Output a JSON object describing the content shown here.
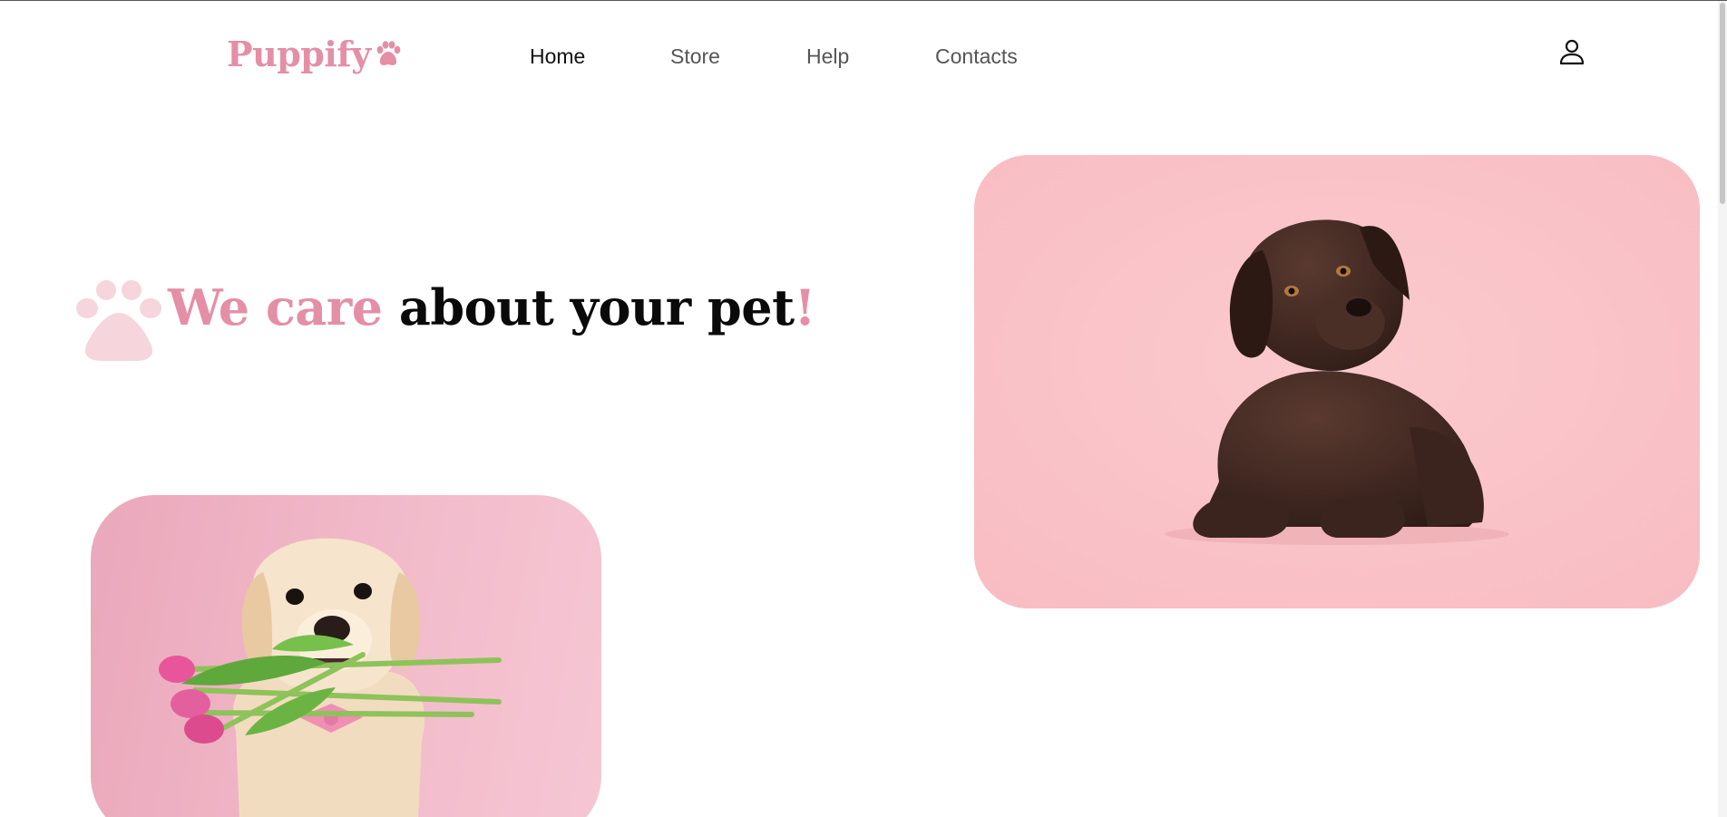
{
  "brand": {
    "name": "Puppify",
    "logo_icon": "paw-icon",
    "accent_color": "#e48fa6"
  },
  "nav": {
    "items": [
      {
        "label": "Home",
        "active": true
      },
      {
        "label": "Store",
        "active": false
      },
      {
        "label": "Help",
        "active": false
      },
      {
        "label": "Contacts",
        "active": false
      }
    ]
  },
  "header": {
    "user_icon": "user-icon"
  },
  "hero": {
    "title_pink": "We care",
    "title_dark": " about your pet",
    "title_punct": "!",
    "decor_icon": "paw-icon"
  },
  "images": {
    "large": "chocolate-labrador-puppy-photo",
    "small": "golden-retriever-with-tulips-photo"
  }
}
